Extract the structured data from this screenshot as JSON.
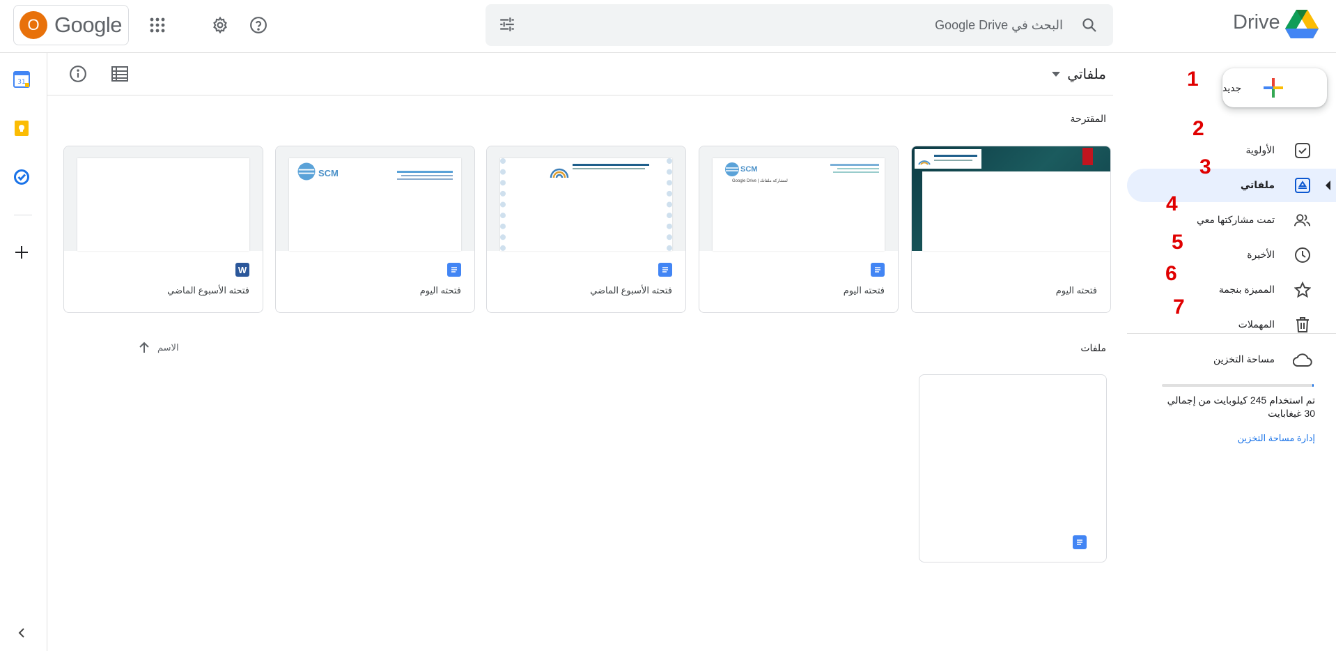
{
  "header": {
    "avatar_letter": "O",
    "wordmark": "Google",
    "search_placeholder": "البحث في Google Drive",
    "drive_title": "Drive"
  },
  "toolbar": {
    "breadcrumb": "ملفاتي"
  },
  "suggested": {
    "label": "المقترحة",
    "cards": [
      {
        "caption": "فتحته اليوم",
        "type": "",
        "thumb": "dark"
      },
      {
        "caption": "فتحته اليوم",
        "type": "doc",
        "thumb": "letterhead"
      },
      {
        "caption": "فتحته الأسبوع الماضي",
        "type": "doc",
        "thumb": "certificate"
      },
      {
        "caption": "فتحته اليوم",
        "type": "doc",
        "thumb": "letterhead"
      },
      {
        "caption": "فتحته الأسبوع الماضي",
        "type": "word",
        "thumb": "blank"
      }
    ],
    "word_badge": "W",
    "thumb_logo_text": "SCM",
    "thumb_small_text": "Google Drive | لمشاركة ملفاتك"
  },
  "files": {
    "label": "ملفات",
    "sort_label": "الاسم",
    "tile_type": "doc"
  },
  "nav": {
    "new_label": "جديد",
    "items": [
      {
        "label": "الأولوية",
        "icon": "priority-icon"
      },
      {
        "label": "ملفاتي",
        "icon": "my-drive-icon",
        "active": true
      },
      {
        "label": "تمت مشاركتها معي",
        "icon": "shared-icon"
      },
      {
        "label": "الأخيرة",
        "icon": "recent-icon"
      },
      {
        "label": "المميزة بنجمة",
        "icon": "star-icon"
      },
      {
        "label": "المهملات",
        "icon": "trash-icon"
      }
    ],
    "storage_label": "مساحة التخزين",
    "storage_used_text": "تم استخدام 245 كيلوبايت من إجمالي 30 غيغابايت",
    "storage_used_fraction": 1e-05,
    "manage_storage": "إدارة مساحة التخزين"
  },
  "annotations": [
    "1",
    "2",
    "3",
    "4",
    "5",
    "6",
    "7"
  ],
  "colors": {
    "accent": "#1a73e8",
    "active_nav_bg": "#e8f0fe",
    "annotation_red": "#e00000",
    "avatar": "#e8710a"
  }
}
